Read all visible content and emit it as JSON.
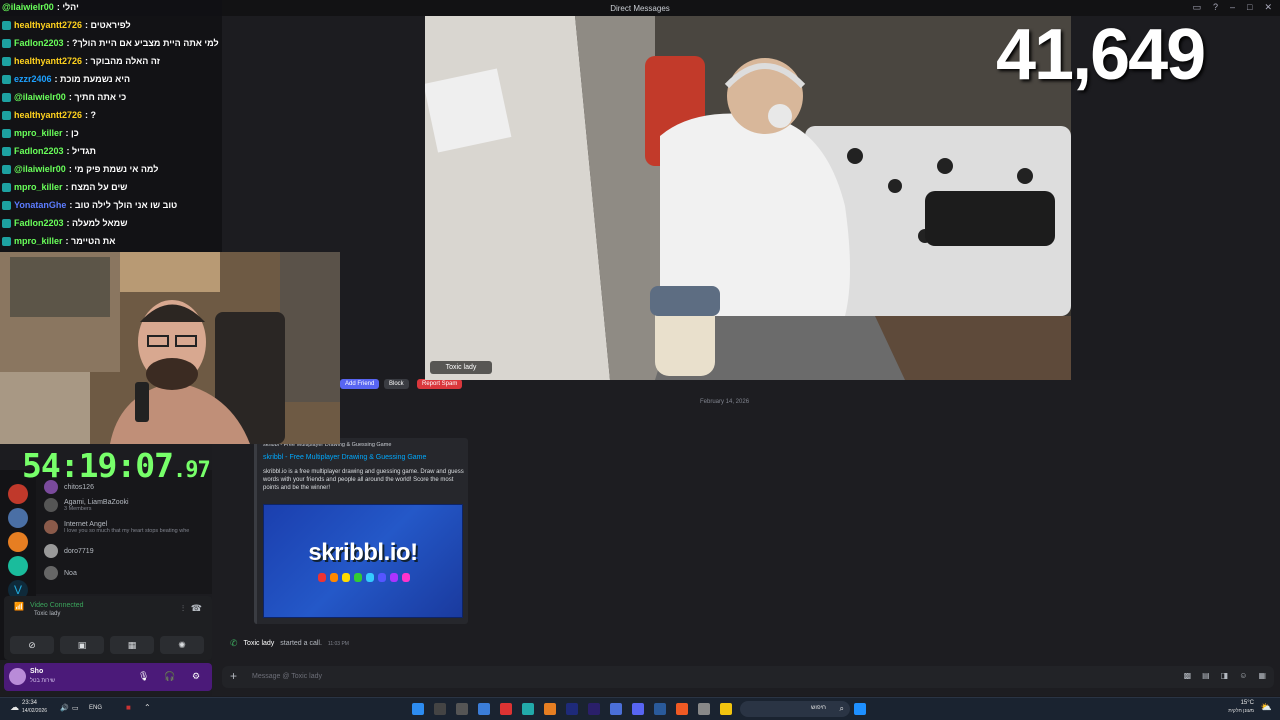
{
  "titlebar": {
    "title": "Direct Messages"
  },
  "viewer_count": "41,649",
  "timer": {
    "main": "54:19:07",
    "fraction": ".97"
  },
  "stream": {
    "nameplate": "Toxic lady"
  },
  "chat_overlay": [
    {
      "user": "@ilaiwielr00",
      "msg": ": יהלי",
      "color": "#69ff5a"
    },
    {
      "user": "healthyantt2726",
      "msg": ": לפיראטים",
      "color": "#ffd21e"
    },
    {
      "user": "Fadlon2203",
      "msg": ": ?למי אתה היית מצביע אם היית הולך",
      "color": "#69ff5a"
    },
    {
      "user": "healthyantt2726",
      "msg": ": זה האלה מהבוקר",
      "color": "#ffd21e"
    },
    {
      "user": "ezzr2406",
      "msg": ": היא נשמעת מוכת",
      "color": "#1da1ff"
    },
    {
      "user": "@ilaiwielr00",
      "msg": ": כי אתה חתיך",
      "color": "#69ff5a"
    },
    {
      "user": "healthyantt2726",
      "msg": ": ?",
      "color": "#ffd21e"
    },
    {
      "user": "mpro_killer",
      "msg": ": כן",
      "color": "#69ff5a"
    },
    {
      "user": "Fadlon2203",
      "msg": ": תגדיל",
      "color": "#69ff5a"
    },
    {
      "user": "@ilaiwielr00",
      "msg": ": למה אי נשמת פיק מי",
      "color": "#69ff5a"
    },
    {
      "user": "mpro_killer",
      "msg": ": שים על המצח",
      "color": "#69ff5a"
    },
    {
      "user": "YonatanGhe",
      "msg": ": טוב שו אני הולך לילה טוב",
      "color": "#5c7cff"
    },
    {
      "user": "Fadlon2203",
      "msg": ": שמאל למעלה",
      "color": "#69ff5a"
    },
    {
      "user": "mpro_killer",
      "msg": ": את הטיימר",
      "color": "#69ff5a"
    }
  ],
  "dm_list": [
    {
      "name": "chitos126",
      "sub": ""
    },
    {
      "name": "Agami, LiamBaZooki",
      "sub": "3 Members"
    },
    {
      "name": "Internet Angel",
      "sub": "I love you so much that my heart stops beating whe"
    },
    {
      "name": "doro7719",
      "sub": ""
    },
    {
      "name": "Noa",
      "sub": ""
    }
  ],
  "voice": {
    "status": "Video Connected",
    "channel": "Toxic lady"
  },
  "user_panel": {
    "name": "Sho",
    "status": "שירות בטל"
  },
  "actions": {
    "add_friend": "Add Friend",
    "block": "Block",
    "report": "Report Spam"
  },
  "chat": {
    "date": "February 14, 2026",
    "embed": {
      "site": "skribbl - Free Multiplayer Drawing & Guessing Game",
      "title": "skribbl - Free Multiplayer Drawing & Guessing Game",
      "description": "skribbl.io is a free multiplayer drawing and guessing game. Draw and guess words with your friends and people all around the world! Score the most points and be the winner!",
      "logo": "skribbl.io!"
    },
    "call": {
      "name": "Toxic lady",
      "text": "started a call.",
      "time": "11:03 PM"
    },
    "input_placeholder": "Message @ Toxic lady"
  },
  "taskbar": {
    "clock_time": "23:34",
    "clock_date": "14/02/2026",
    "lang": "ENG",
    "weather": "15°C",
    "weather_sub": "מעונן חלקית",
    "search": "חיפוש"
  },
  "colors": {
    "accent": "#5865f2",
    "danger": "#da373c",
    "online": "#3ba55c"
  }
}
